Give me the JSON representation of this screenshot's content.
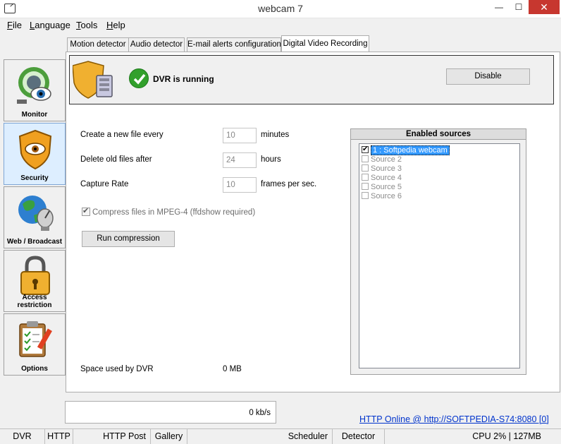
{
  "window": {
    "title": "webcam 7",
    "minimize": "—",
    "maximize": "☐",
    "close": "✕"
  },
  "menu": [
    "File",
    "Language",
    "Tools",
    "Help"
  ],
  "sidebar": [
    {
      "label": "Monitor",
      "icon": "eye-camera-icon"
    },
    {
      "label": "Security",
      "icon": "shield-eye-icon",
      "active": true
    },
    {
      "label": "Web / Broadcast",
      "icon": "globe-satellite-icon"
    },
    {
      "label": "Access restriction",
      "icon": "padlock-icon"
    },
    {
      "label": "Options",
      "icon": "clipboard-pencil-icon"
    }
  ],
  "tabs": [
    "Motion detector",
    "Audio detector",
    "E-mail alerts configuration",
    "Digital Video Recording"
  ],
  "dvr": {
    "status": "DVR is running",
    "disable_label": "Disable",
    "new_file_label": "Create a new file every",
    "new_file_value": "10",
    "new_file_unit": "minutes",
    "delete_label": "Delete old files after",
    "delete_value": "24",
    "delete_unit": "hours",
    "capture_label": "Capture Rate",
    "capture_value": "10",
    "capture_unit": "frames per sec.",
    "compress_label": "Compress files in MPEG-4 (ffdshow required)",
    "run_label": "Run compression",
    "space_label": "Space used by DVR",
    "space_value": "0 MB"
  },
  "sources": {
    "title": "Enabled sources",
    "items": [
      "1 : Softpedia webcam",
      "Source 2",
      "Source 3",
      "Source 4",
      "Source 5",
      "Source 6"
    ]
  },
  "bandwidth": "0 kb/s",
  "http_link": "HTTP Online @ http://SOFTPEDIA-S74:8080 [0]",
  "statusbar": [
    "DVR",
    "HTTP",
    "HTTP Post",
    "Gallery",
    "Scheduler",
    "Detector",
    "CPU 2% | 127MB"
  ]
}
